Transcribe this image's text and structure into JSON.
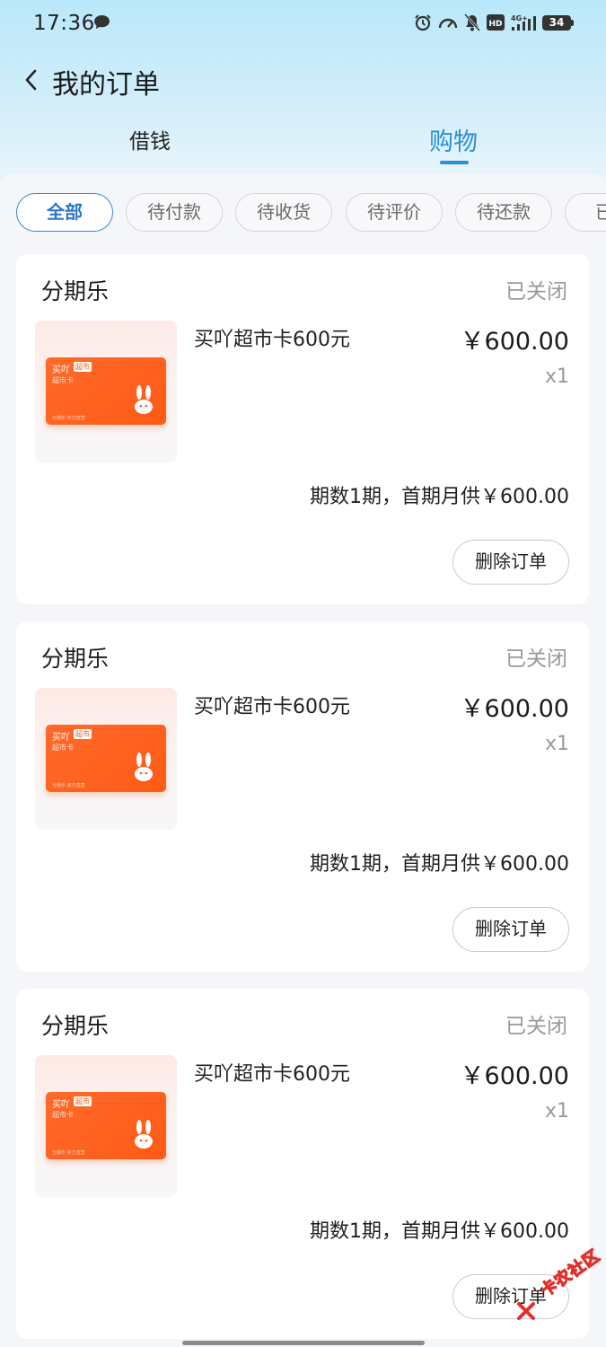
{
  "status_bar": {
    "time": "17:36",
    "network": "4G",
    "battery": "34"
  },
  "header": {
    "title": "我的订单"
  },
  "tabs": [
    {
      "label": "借钱",
      "active": false
    },
    {
      "label": "购物",
      "active": true
    }
  ],
  "filters": [
    {
      "label": "全部",
      "active": true
    },
    {
      "label": "待付款",
      "active": false
    },
    {
      "label": "待收货",
      "active": false
    },
    {
      "label": "待评价",
      "active": false
    },
    {
      "label": "待还款",
      "active": false
    },
    {
      "label": "已完",
      "active": false
    }
  ],
  "orders": [
    {
      "merchant": "分期乐",
      "status": "已关闭",
      "product_name": "买吖超市卡600元",
      "price": "￥600.00",
      "quantity": "x1",
      "installment": "期数1期，首期月供￥600.00",
      "delete_label": "删除订单",
      "card_brand": "买吖",
      "card_brand_tag": "超市",
      "card_sub": "超市卡",
      "card_foot": "分期乐·官方直营"
    },
    {
      "merchant": "分期乐",
      "status": "已关闭",
      "product_name": "买吖超市卡600元",
      "price": "￥600.00",
      "quantity": "x1",
      "installment": "期数1期，首期月供￥600.00",
      "delete_label": "删除订单",
      "card_brand": "买吖",
      "card_brand_tag": "超市",
      "card_sub": "超市卡",
      "card_foot": "分期乐·官方直营"
    },
    {
      "merchant": "分期乐",
      "status": "已关闭",
      "product_name": "买吖超市卡600元",
      "price": "￥600.00",
      "quantity": "x1",
      "installment": "期数1期，首期月供￥600.00",
      "delete_label": "删除订单",
      "card_brand": "买吖",
      "card_brand_tag": "超市",
      "card_sub": "超市卡",
      "card_foot": "分期乐·官方直营"
    }
  ],
  "watermark": "卡农社区",
  "colors": {
    "accent": "#2a8fd6",
    "chip_active": "#3b86d3",
    "card_orange": "#ff5a16",
    "header_gradient_top": "#b9e8fa"
  }
}
